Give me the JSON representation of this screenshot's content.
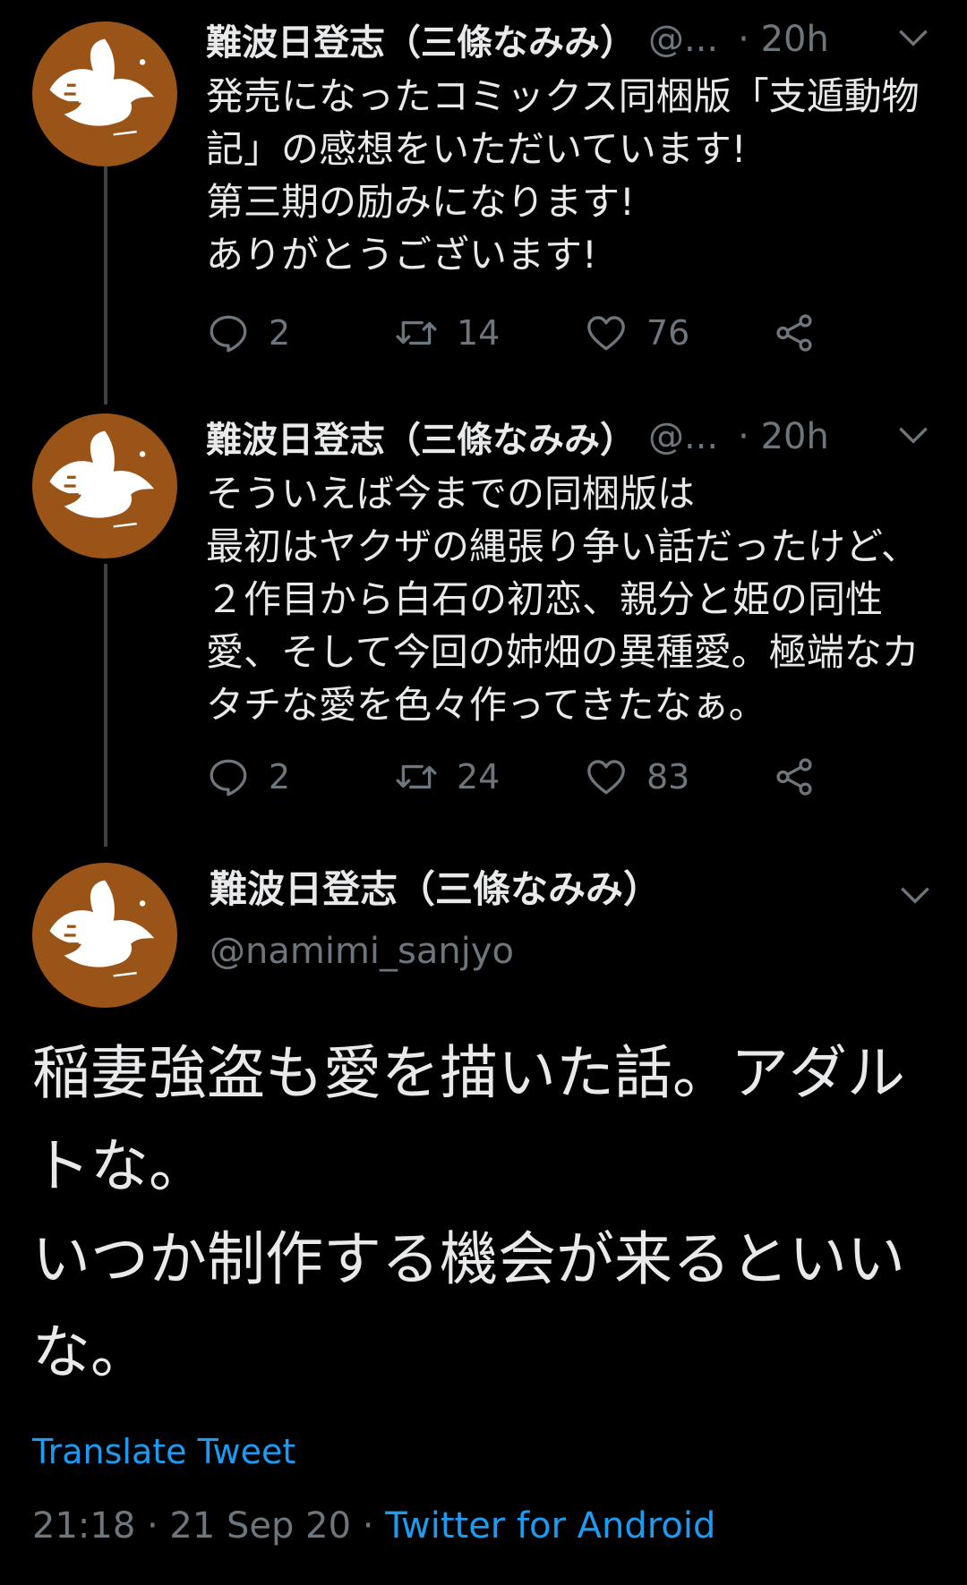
{
  "colors": {
    "background": "#000000",
    "text": "#e7e9ea",
    "muted": "#6e767d",
    "link": "#1d9bf0",
    "avatar_bg": "#9a5418",
    "thread_line": "#3d4145"
  },
  "icons": {
    "reply": "reply-bubble-icon",
    "retweet": "retweet-arrows-icon",
    "like": "heart-outline-icon",
    "share": "share-nodes-icon",
    "menu": "chevron-down-icon",
    "avatar": "white-dove-avatar"
  },
  "tweets": [
    {
      "name": "難波日登志（三條なみみ）",
      "handle": "@...",
      "time": "· 20h",
      "text": "発売になったコミックス同梱版「支遁動物記」の感想をいただいています!\n第三期の励みになります!\nありがとうございます!",
      "replies": "2",
      "retweets": "14",
      "likes": "76"
    },
    {
      "name": "難波日登志（三條なみみ）",
      "handle": "@...",
      "time": "· 20h",
      "text": "そういえば今までの同梱版は\n最初はヤクザの縄張り争い話だったけど、２作目から白石の初恋、親分と姫の同性愛、そして今回の姉畑の異種愛。極端なカタチな愛を色々作ってきたなぁ。",
      "replies": "2",
      "retweets": "24",
      "likes": "83"
    }
  ],
  "main_tweet": {
    "name": "難波日登志（三條なみみ）",
    "handle": "@namimi_sanjyo",
    "text": "稲妻強盗も愛を描いた話。アダルトな。\nいつか制作する機会が来るといいな。",
    "translate_label": "Translate Tweet",
    "timestamp": "21:18 · 21 Sep 20 · ",
    "source": "Twitter for Android"
  }
}
